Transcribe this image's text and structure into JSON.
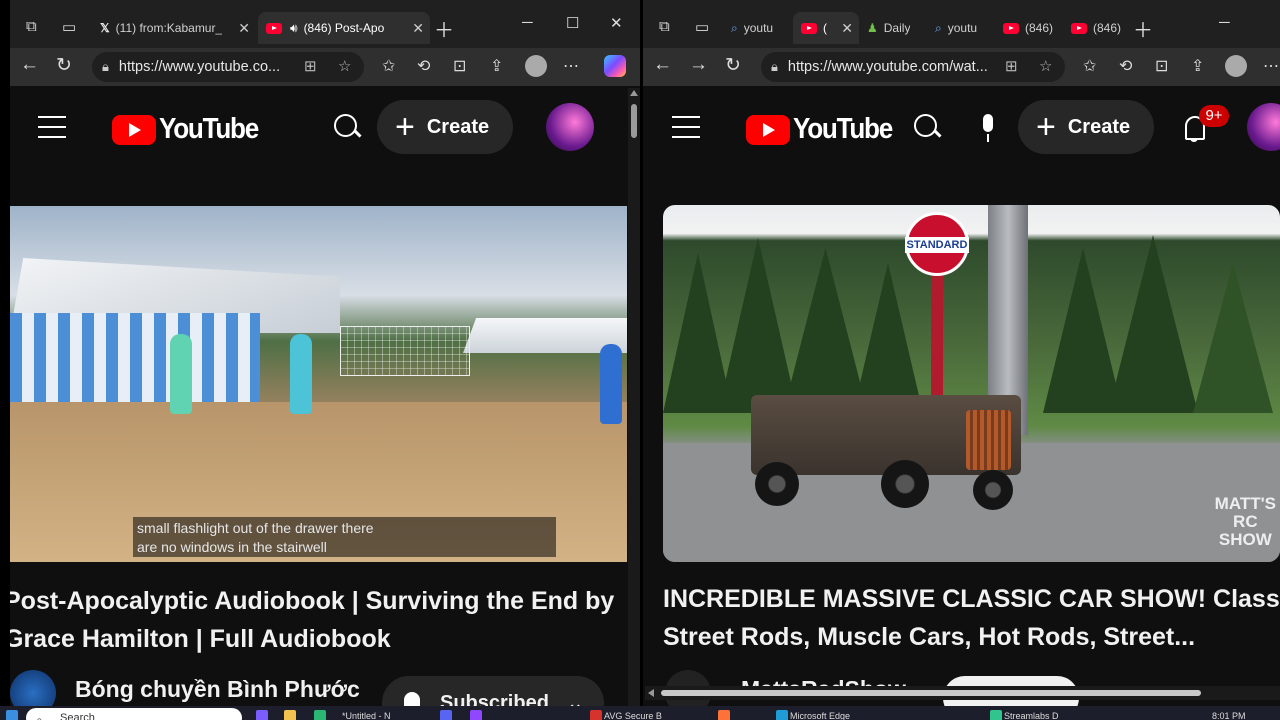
{
  "left_window": {
    "tabs": [
      {
        "title": "(11) from:Kabamur_",
        "favicon": "x-icon",
        "active": false
      },
      {
        "title": "(846) Post-Apo",
        "favicon": "youtube-icon",
        "active": true,
        "audio": true
      }
    ],
    "url": "https://www.youtube.co...",
    "youtube": {
      "logo_text": "YouTube",
      "create_label": "Create",
      "caption_lines": [
        "small flashlight out of the drawer there",
        "are no windows in the stairwell"
      ],
      "title_line1": "Post-Apocalyptic Audiobook | Surviving the End by",
      "title_line2": "Grace Hamilton | Full Audiobook",
      "channel_name": "Bóng chuyền Bình Phước",
      "subscribe_label": "Subscribed"
    }
  },
  "right_window": {
    "tabs": [
      {
        "title": "youtu",
        "favicon": "search-icon",
        "active": false
      },
      {
        "title": "(",
        "favicon": "youtube-icon",
        "active": true
      },
      {
        "title": "Daily",
        "favicon": "chess-icon",
        "active": false
      },
      {
        "title": "youtu",
        "favicon": "search-icon",
        "active": false
      },
      {
        "title": "(846)",
        "favicon": "youtube-icon",
        "active": false
      },
      {
        "title": "(846)",
        "favicon": "youtube-icon",
        "active": false
      }
    ],
    "url": "https://www.youtube.com/wat...",
    "youtube": {
      "logo_text": "YouTube",
      "create_label": "Create",
      "notification_count": "9+",
      "sign_text": "STANDARD",
      "watermark": "MATT'S\nRC\nSHOW",
      "title_line1": "INCREDIBLE MASSIVE CLASSIC CAR SHOW! Class",
      "title_line2": "Street Rods, Muscle Cars, Hot Rods, Street...",
      "channel_name": "MattsRadShow"
    }
  },
  "taskbar": {
    "search_placeholder": "Search",
    "items": [
      "*Untitled - N",
      "AVG Secure B",
      "Microsoft Edge",
      "Streamlabs D"
    ],
    "clock": "8:01 PM"
  },
  "colors": {
    "youtube_red": "#ff0000",
    "badge_red": "#cc0000",
    "bg": "#0f0f0f",
    "chrome": "#202020"
  }
}
